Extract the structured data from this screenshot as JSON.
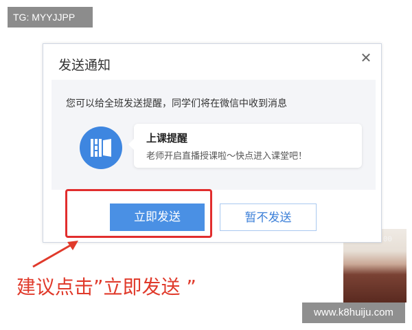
{
  "watermark_top_left": "TG: MYYJJPP",
  "watermark_bottom_right": "www.k8huiju.com",
  "video_timer": "00:00",
  "dialog": {
    "title": "发送通知",
    "close_symbol": "✕",
    "description": "您可以给全班发送提醒，同学们将在微信中收到消息",
    "notice_title": "上课提醒",
    "notice_text": "老师开启直播授课啦～快点进入课堂吧！",
    "send_label": "立即发送",
    "later_label": "暂不发送"
  },
  "annotation": {
    "text": "建议点击”立即发送 ”",
    "color": "#e12d2d"
  },
  "colors": {
    "primary": "#4a90e4",
    "logo": "#3e86e0"
  },
  "icons": {
    "close": "close-icon",
    "app_logo": "app-logo-icon",
    "arrow": "arrow-icon"
  }
}
